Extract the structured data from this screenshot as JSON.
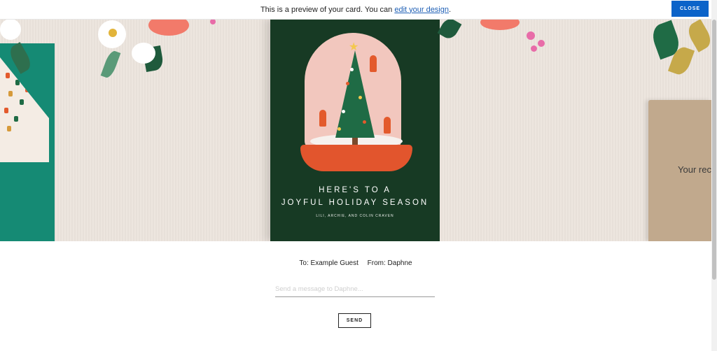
{
  "banner": {
    "message": "This is a preview of your card. You can",
    "link_text": "edit your design",
    "period": ".",
    "close_label": "CLOSE"
  },
  "card": {
    "headline_line1": "HERE'S TO A",
    "headline_line2": "JOYFUL HOLIDAY SEASON",
    "credit": "LILI, ARCHIE, AND COLIN CRAVEN"
  },
  "envelope_right": {
    "text": "Your rec"
  },
  "recipient": {
    "to": "To: Example Guest",
    "from": "From: Daphne"
  },
  "reply": {
    "placeholder": "Send a message to Daphne...",
    "send_label": "SEND"
  },
  "colors": {
    "accent": "#0b63c9",
    "card_green": "#173a24",
    "envelope_teal": "#158a74"
  }
}
